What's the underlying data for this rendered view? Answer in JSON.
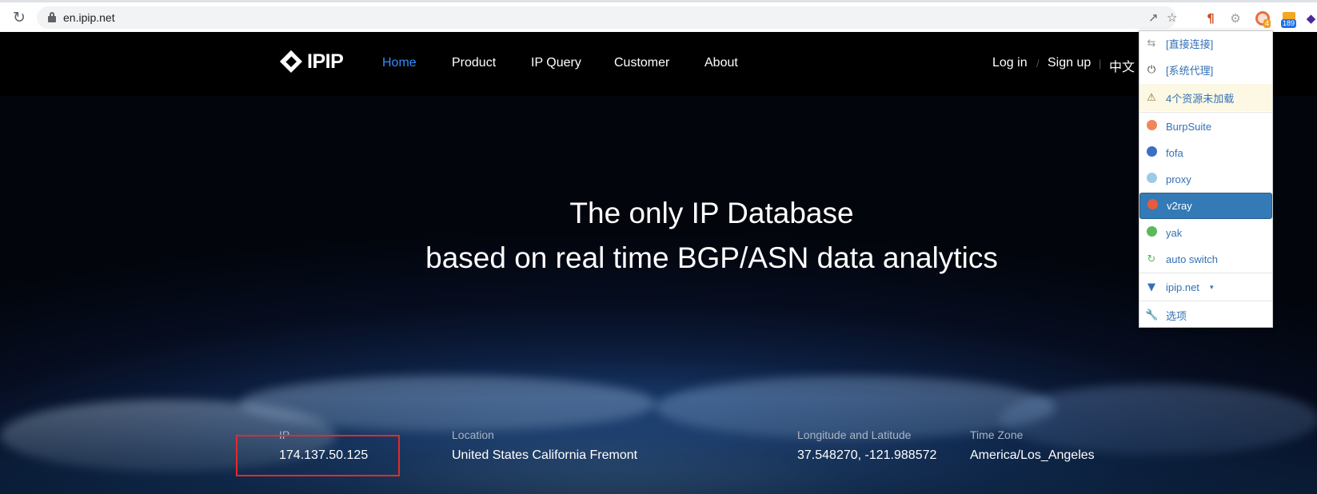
{
  "browser": {
    "url": "en.ipip.net",
    "reload_icon": "reload-icon",
    "extension_badge": "189",
    "proxy_badge": "4"
  },
  "site": {
    "logo_text": "IPIP",
    "nav": {
      "home": "Home",
      "product": "Product",
      "ip_query": "IP Query",
      "customer": "Customer",
      "about": "About"
    },
    "auth": {
      "login": "Log in",
      "separator": "/",
      "signup": "Sign up",
      "separator2": "|",
      "language": "中文"
    },
    "headline_line1": "The only IP Database",
    "headline_line2": "based on real time BGP/ASN data analytics",
    "info": {
      "ip_label": "IP",
      "ip_value": "174.137.50.125",
      "location_label": "Location",
      "location_value": "United States California Fremont",
      "lonlat_label": "Longitude and Latitude",
      "lonlat_value": "37.548270, -121.988572",
      "timezone_label": "Time Zone",
      "timezone_value": "America/Los_Angeles"
    }
  },
  "proxy_popup": {
    "items": [
      {
        "label": "[直接连接]",
        "icon": "swap-icon"
      },
      {
        "label": "[系统代理]",
        "icon": "power-icon"
      },
      {
        "label": "4个资源未加载",
        "icon": "warning-icon"
      },
      {
        "label": "BurpSuite",
        "icon": "globe-icon",
        "color": "#f0875a"
      },
      {
        "label": "fofa",
        "icon": "globe-icon",
        "color": "#3a6fc4"
      },
      {
        "label": "proxy",
        "icon": "globe-icon",
        "color": "#9ccbe6"
      },
      {
        "label": "v2ray",
        "icon": "globe-icon",
        "color": "#e65c3a"
      },
      {
        "label": "yak",
        "icon": "globe-icon",
        "color": "#5cb85c"
      },
      {
        "label": "auto switch",
        "icon": "switch-icon",
        "color": "#5cb85c"
      },
      {
        "label": "ipip.net",
        "icon": "filter-icon"
      },
      {
        "label": "选项",
        "icon": "wrench-icon"
      }
    ]
  },
  "colors": {
    "nav_active": "#2f8fff",
    "highlight_box": "#e22b2b",
    "popup_selected": "#337ab7",
    "popup_link": "#3371b7"
  }
}
